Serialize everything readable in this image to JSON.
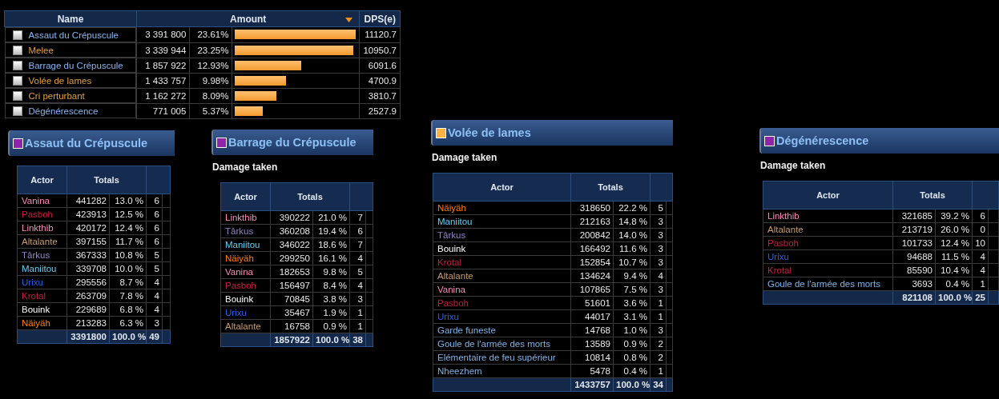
{
  "summary": {
    "columns": [
      "Name",
      "Amount",
      "DPS(e)"
    ],
    "rows": [
      {
        "name": "Assaut du Crépuscule",
        "color": "#8ab4ee",
        "amount": "3 391 800",
        "percent": "23.61%",
        "level": 0.99,
        "dps": "11120.7",
        "checked": false
      },
      {
        "name": "Melee",
        "color": "#e0a040",
        "amount": "3 339 944",
        "percent": "23.25%",
        "level": 0.97,
        "dps": "10950.7",
        "checked": false
      },
      {
        "name": "Barrage du Crépuscule",
        "color": "#8ab4ee",
        "amount": "1 857 922",
        "percent": "12.93%",
        "level": 0.54,
        "dps": "6091.6",
        "checked": false
      },
      {
        "name": "Volée de lames",
        "color": "#e0a040",
        "amount": "1 433 757",
        "percent": "9.98%",
        "level": 0.42,
        "dps": "4700.9",
        "checked": false
      },
      {
        "name": "Cri perturbant",
        "color": "#e0a040",
        "amount": "1 162 272",
        "percent": "8.09%",
        "level": 0.34,
        "dps": "3810.7",
        "checked": false
      },
      {
        "name": "Dégénérescence",
        "color": "#8ab4ee",
        "amount": "771 005",
        "percent": "5.37%",
        "level": 0.23,
        "dps": "2527.9",
        "checked": false
      }
    ]
  },
  "panels": [
    {
      "title": "Assaut du Crépuscule",
      "color": "#8e24aa",
      "columns": [
        "Actor",
        "Totals"
      ],
      "rows": [
        {
          "actor": "Vanina",
          "color": "#f58cba",
          "total": "441282",
          "percent": "13.0 %",
          "count": "6"
        },
        {
          "actor": "Pasboh",
          "color": "#c41f3b",
          "total": "423913",
          "percent": "12.5 %",
          "count": "6"
        },
        {
          "actor": "Linkthib",
          "color": "#f58cba",
          "total": "420172",
          "percent": "12.4 %",
          "count": "6"
        },
        {
          "actor": "Altalante",
          "color": "#c79c6e",
          "total": "397155",
          "percent": "11.7 %",
          "count": "6"
        },
        {
          "actor": "Târkus",
          "color": "#9482c9",
          "total": "367333",
          "percent": "10.8 %",
          "count": "5"
        },
        {
          "actor": "Maniitou",
          "color": "#69ccf0",
          "total": "339708",
          "percent": "10.0 %",
          "count": "5"
        },
        {
          "actor": "Urixu",
          "color": "#2a5ee8",
          "total": "295556",
          "percent": "8.7 %",
          "count": "4"
        },
        {
          "actor": "Krotal",
          "color": "#c41f3b",
          "total": "263709",
          "percent": "7.8 %",
          "count": "4"
        },
        {
          "actor": "Bouink",
          "color": "#ffffff",
          "total": "229689",
          "percent": "6.8 %",
          "count": "4"
        },
        {
          "actor": "Näiyäh",
          "color": "#ff7d0a",
          "total": "213283",
          "percent": "6.3 %",
          "count": "3"
        }
      ],
      "footer": {
        "total": "3391800",
        "percent": "100.0 %",
        "count": "49"
      }
    },
    {
      "title": "Barrage du Crépuscule",
      "color": "#8e24aa",
      "subtitle": "Damage taken",
      "columns": [
        "Actor",
        "Totals"
      ],
      "rows": [
        {
          "actor": "Linkthib",
          "color": "#f58cba",
          "total": "390222",
          "percent": "21.0 %",
          "count": "7"
        },
        {
          "actor": "Târkus",
          "color": "#9482c9",
          "total": "360208",
          "percent": "19.4 %",
          "count": "6"
        },
        {
          "actor": "Maniitou",
          "color": "#69ccf0",
          "total": "346022",
          "percent": "18.6 %",
          "count": "7"
        },
        {
          "actor": "Näiyäh",
          "color": "#ff7d0a",
          "total": "299250",
          "percent": "16.1 %",
          "count": "4"
        },
        {
          "actor": "Vanina",
          "color": "#f58cba",
          "total": "182653",
          "percent": "9.8 %",
          "count": "5"
        },
        {
          "actor": "Pasboh",
          "color": "#c41f3b",
          "total": "156497",
          "percent": "8.4 %",
          "count": "4"
        },
        {
          "actor": "Bouink",
          "color": "#ffffff",
          "total": "70845",
          "percent": "3.8 %",
          "count": "3"
        },
        {
          "actor": "Urixu",
          "color": "#2a5ee8",
          "total": "35467",
          "percent": "1.9 %",
          "count": "1"
        },
        {
          "actor": "Altalante",
          "color": "#c79c6e",
          "total": "16758",
          "percent": "0.9 %",
          "count": "1"
        }
      ],
      "footer": {
        "total": "1857922",
        "percent": "100.0 %",
        "count": "38"
      }
    },
    {
      "title": "Volée de lames",
      "color": "#ffb347",
      "subtitle": "Damage taken",
      "columns": [
        "Actor",
        "Totals"
      ],
      "rows": [
        {
          "actor": "Näiyäh",
          "color": "#ff7d0a",
          "total": "318650",
          "percent": "22.2 %",
          "count": "5"
        },
        {
          "actor": "Maniitou",
          "color": "#69ccf0",
          "total": "212163",
          "percent": "14.8 %",
          "count": "3"
        },
        {
          "actor": "Târkus",
          "color": "#9482c9",
          "total": "200842",
          "percent": "14.0 %",
          "count": "3"
        },
        {
          "actor": "Bouink",
          "color": "#ffffff",
          "total": "166492",
          "percent": "11.6 %",
          "count": "3"
        },
        {
          "actor": "Krotal",
          "color": "#c41f3b",
          "total": "152854",
          "percent": "10.7 %",
          "count": "3"
        },
        {
          "actor": "Altalante",
          "color": "#c79c6e",
          "total": "134624",
          "percent": "9.4 %",
          "count": "4"
        },
        {
          "actor": "Vanina",
          "color": "#f58cba",
          "total": "107865",
          "percent": "7.5 %",
          "count": "3"
        },
        {
          "actor": "Pasboh",
          "color": "#c41f3b",
          "total": "51601",
          "percent": "3.6 %",
          "count": "1"
        },
        {
          "actor": "Urixu",
          "color": "#2a5ee8",
          "total": "44017",
          "percent": "3.1 %",
          "count": "1"
        },
        {
          "actor": "Garde funeste",
          "color": "#7fb2e5",
          "total": "14768",
          "percent": "1.0 %",
          "count": "3"
        },
        {
          "actor": "Goule de l'armée des morts",
          "color": "#7fb2e5",
          "total": "13589",
          "percent": "0.9 %",
          "count": "2"
        },
        {
          "actor": "Elémentaire de feu supérieur",
          "color": "#7fb2e5",
          "total": "10814",
          "percent": "0.8 %",
          "count": "2"
        },
        {
          "actor": "Nheezhem",
          "color": "#7fb2e5",
          "total": "5478",
          "percent": "0.4 %",
          "count": "1"
        }
      ],
      "footer": {
        "total": "1433757",
        "percent": "100.0 %",
        "count": "34"
      }
    },
    {
      "title": "Dégénérescence",
      "color": "#8e24aa",
      "subtitle": "Damage taken",
      "columns": [
        "Actor",
        "Totals"
      ],
      "rows": [
        {
          "actor": "Linkthib",
          "color": "#f58cba",
          "total": "321685",
          "percent": "39.2 %",
          "count": "6"
        },
        {
          "actor": "Altalante",
          "color": "#c79c6e",
          "total": "213719",
          "percent": "26.0 %",
          "count": "0"
        },
        {
          "actor": "Pasboh",
          "color": "#c41f3b",
          "total": "101733",
          "percent": "12.4 %",
          "count": "10"
        },
        {
          "actor": "Urixu",
          "color": "#2a5ee8",
          "total": "94688",
          "percent": "11.5 %",
          "count": "4"
        },
        {
          "actor": "Krotal",
          "color": "#c41f3b",
          "total": "85590",
          "percent": "10.4 %",
          "count": "4"
        },
        {
          "actor": "Goule de l'armée des morts",
          "color": "#7fb2e5",
          "total": "3693",
          "percent": "0.4 %",
          "count": "1"
        }
      ],
      "footer": {
        "total": "821108",
        "percent": "100.0 %",
        "count": "25"
      }
    }
  ]
}
